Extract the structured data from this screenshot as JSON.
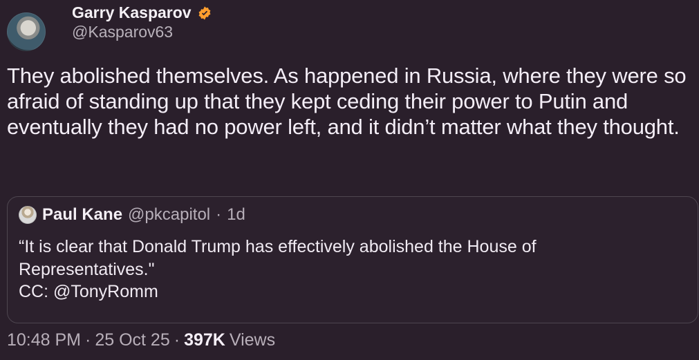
{
  "tweet": {
    "author": {
      "display_name": "Garry Kasparov",
      "handle": "@Kasparov63",
      "verified_color": "#ff9f2e"
    },
    "text": "They abolished themselves. As happened in Russia, where they were so afraid of standing up that they kept ceding their power to Putin and eventually they had no power left, and it didn’t matter what they thought.",
    "quoted_tweet": {
      "display_name": "Paul Kane",
      "handle": "@pkcapitol",
      "separator": "·",
      "time": "1d",
      "line1": "“It is clear that Donald Trump has effectively abolished the House of",
      "line2": "Representatives.\"",
      "line3": "CC: @TonyRomm"
    },
    "meta": {
      "timestamp": "10:48 PM",
      "separator1": "·",
      "date": "25 Oct 25",
      "separator2": "·",
      "views_count": "397K",
      "views_label": "Views"
    }
  },
  "icons": {
    "avatar": "avatar",
    "verified": "verified-badge-icon",
    "quote_avatar": "quoted-avatar"
  },
  "colors": {
    "background": "#2a1f2b",
    "primary_text": "#f4eef7",
    "secondary_text": "#b8afb9",
    "border": "#4e4650"
  }
}
